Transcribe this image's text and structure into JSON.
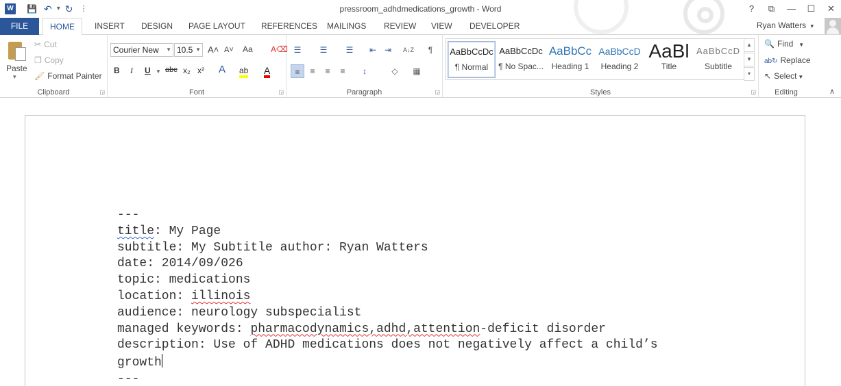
{
  "window": {
    "title": "pressroom_adhdmedications_growth - Word",
    "controls": {
      "help": "?",
      "restore_ribbon": "⧉",
      "minimize": "—",
      "maximize": "☐",
      "close": "✕"
    }
  },
  "qat": {
    "word_logo": "W",
    "save": "💾",
    "undo": "↶",
    "undo_dd": "▾",
    "redo": "↻",
    "customize": "⋮"
  },
  "tabs": {
    "file": "FILE",
    "items": [
      "HOME",
      "INSERT",
      "DESIGN",
      "PAGE LAYOUT",
      "REFERENCES",
      "MAILINGS",
      "REVIEW",
      "VIEW",
      "DEVELOPER"
    ]
  },
  "user": {
    "name": "Ryan Watters",
    "dropdown": "▾"
  },
  "ribbon": {
    "clipboard": {
      "label": "Clipboard",
      "paste": "Paste",
      "paste_dd": "▾",
      "cut": "Cut",
      "copy": "Copy",
      "format_painter": "Format Painter"
    },
    "font": {
      "label": "Font",
      "font_name": "Courier New",
      "font_size": "10.5",
      "grow": "A˄",
      "shrink": "A˅",
      "case": "Aa",
      "clear": "A⌫",
      "bold": "B",
      "italic": "I",
      "underline": "U",
      "strike": "abc",
      "subscript": "x₂",
      "superscript": "x²",
      "effects": "A",
      "highlight": "ab",
      "color": "A"
    },
    "paragraph": {
      "label": "Paragraph",
      "bullets": "☰",
      "numbering": "☰",
      "multilevel": "☰",
      "decrease_indent": "⇤",
      "increase_indent": "⇥",
      "sort": "A↓Z",
      "show_marks": "¶",
      "align_left": "≡",
      "align_center": "≡",
      "align_right": "≡",
      "justify": "≡",
      "line_spacing": "↕",
      "shading": "◇",
      "borders": "▦"
    },
    "styles": {
      "label": "Styles",
      "items": [
        {
          "sample": "AaBbCcDc",
          "name": "¶ Normal"
        },
        {
          "sample": "AaBbCcDc",
          "name": "¶ No Spac..."
        },
        {
          "sample": "AaBbCc",
          "name": "Heading 1"
        },
        {
          "sample": "AaBbCcD",
          "name": "Heading 2"
        },
        {
          "sample": "AaBl",
          "name": "Title"
        },
        {
          "sample": "AaBbCcD",
          "name": "Subtitle"
        }
      ],
      "scroll_up": "▲",
      "scroll_down": "▼",
      "more": "▾"
    },
    "editing": {
      "label": "Editing",
      "find": "Find",
      "replace": "Replace",
      "select": "Select"
    },
    "collapse": "∧"
  },
  "document": {
    "lines": [
      {
        "parts": [
          {
            "text": "---"
          }
        ]
      },
      {
        "parts": [
          {
            "text": "title",
            "mark": "blue"
          },
          {
            "text": ": My Page"
          }
        ]
      },
      {
        "parts": [
          {
            "text": "subtitle: My Subtitle author: Ryan Watters"
          }
        ]
      },
      {
        "parts": [
          {
            "text": "date: 2014/09/026"
          }
        ]
      },
      {
        "parts": [
          {
            "text": "topic: medications"
          }
        ]
      },
      {
        "parts": [
          {
            "text": "location: "
          },
          {
            "text": "illinois",
            "mark": "red"
          }
        ]
      },
      {
        "parts": [
          {
            "text": "audience: neurology subspecialist"
          }
        ]
      },
      {
        "parts": [
          {
            "text": "managed keywords: "
          },
          {
            "text": "pharmacodynamics,adhd,attention",
            "mark": "red"
          },
          {
            "text": "-deficit disorder"
          }
        ]
      },
      {
        "parts": [
          {
            "text": "description: Use of ADHD medications does not negatively affect a child’s"
          }
        ]
      },
      {
        "parts": [
          {
            "text": "growth"
          }
        ],
        "caret": true
      },
      {
        "parts": [
          {
            "text": "---"
          }
        ]
      }
    ]
  }
}
